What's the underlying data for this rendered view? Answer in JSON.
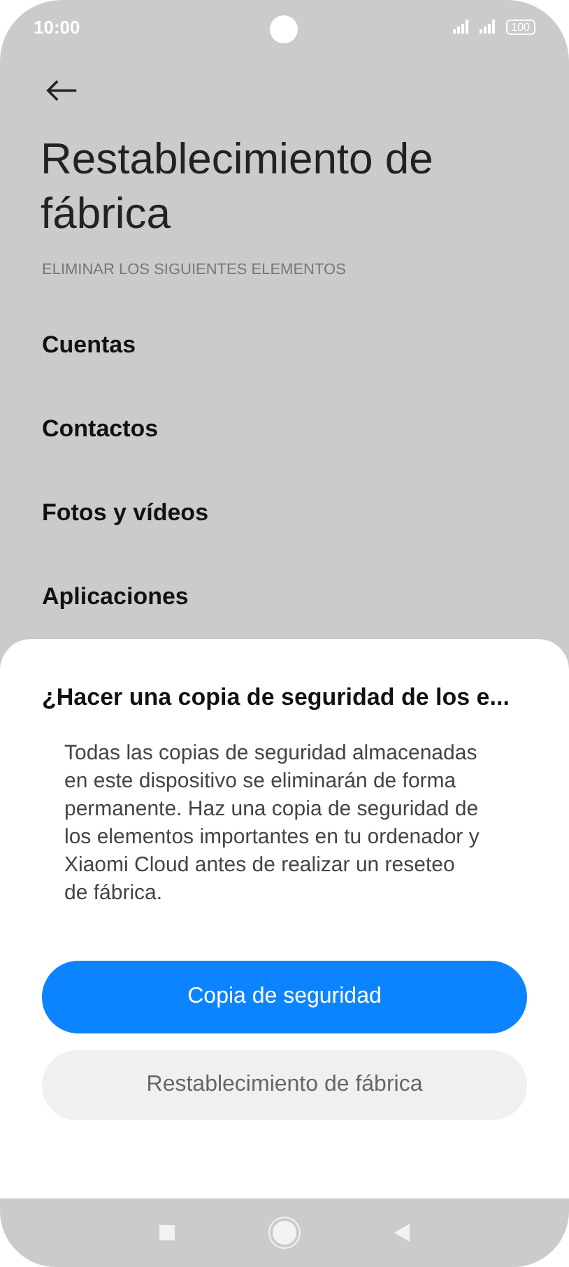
{
  "status_bar": {
    "time": "10:00",
    "battery": "100"
  },
  "page": {
    "title": "Restablecimiento de fábrica",
    "section_header": "ELIMINAR LOS SIGUIENTES ELEMENTOS",
    "items": [
      "Cuentas",
      "Contactos",
      "Fotos y vídeos",
      "Aplicaciones"
    ]
  },
  "dialog": {
    "title": "¿Hacer una copia de seguridad de los e...",
    "message": "Todas las copias de seguridad almacenadas en este dispositivo se eliminarán de forma permanente. Haz una copia de seguridad de los elementos importantes en tu ordenador y Xiaomi Cloud antes de realizar un reseteo de fábrica.",
    "buttons": [
      {
        "label": "Copia de seguridad",
        "kind": "primary"
      },
      {
        "label": "Restablecimiento de fábrica",
        "kind": "secondary"
      }
    ]
  }
}
